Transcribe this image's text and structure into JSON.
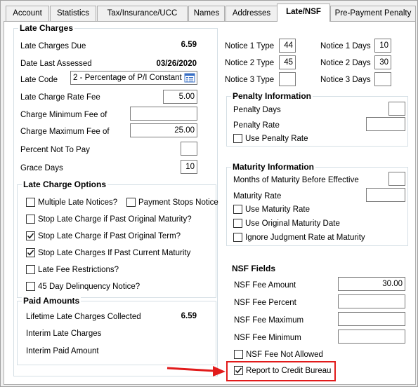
{
  "tabs": [
    {
      "label": "Account"
    },
    {
      "label": "Statistics"
    },
    {
      "label": "Tax/Insurance/UCC"
    },
    {
      "label": "Names"
    },
    {
      "label": "Addresses"
    },
    {
      "label": "Late/NSF"
    },
    {
      "label": "Pre-Payment Penalty"
    }
  ],
  "active_tab": "Late/NSF",
  "late_charges": {
    "title": "Late Charges",
    "due_label": "Late Charges Due",
    "due_value": "6.59",
    "date_label": "Date Last Assessed",
    "date_value": "03/26/2020",
    "code_label": "Late Code",
    "code_value": "2 - Percentage of P/I Constant",
    "rate_fee_label": "Late Charge Rate Fee",
    "rate_fee_value": "5.00",
    "min_fee_label": "Charge Minimum Fee of",
    "min_fee_value": "",
    "max_fee_label": "Charge Maximum Fee of",
    "max_fee_value": "25.00",
    "pct_not_pay_label": "Percent Not To Pay",
    "pct_not_pay_value": "",
    "grace_label": "Grace Days",
    "grace_value": "10"
  },
  "late_charge_options": {
    "title": "Late Charge Options",
    "multiple_notices": {
      "label": "Multiple Late Notices?",
      "checked": false
    },
    "payment_stops_notice": {
      "label": "Payment Stops Notice",
      "checked": false
    },
    "stop_past_orig_maturity": {
      "label": "Stop Late Charge if Past Original Maturity?",
      "checked": false
    },
    "stop_past_orig_term": {
      "label": "Stop Late Charge if Past Original Term?",
      "checked": true
    },
    "stop_past_current_maturity": {
      "label": "Stop Late Charges If Past Current Maturity",
      "checked": true
    },
    "late_fee_restrictions": {
      "label": "Late Fee Restrictions?",
      "checked": false
    },
    "delinquency_notice": {
      "label": "45 Day Delinquency Notice?",
      "checked": false
    }
  },
  "paid_amounts": {
    "title": "Paid Amounts",
    "lifetime_label": "Lifetime Late Charges Collected",
    "lifetime_value": "6.59",
    "interim_late_label": "Interim Late Charges",
    "interim_paid_label": "Interim Paid Amount"
  },
  "notices": {
    "notice1_type_label": "Notice 1 Type",
    "notice1_type_value": "44",
    "notice2_type_label": "Notice 2 Type",
    "notice2_type_value": "45",
    "notice3_type_label": "Notice 3 Type",
    "notice3_type_value": "",
    "notice1_days_label": "Notice 1 Days",
    "notice1_days_value": "10",
    "notice2_days_label": "Notice 2 Days",
    "notice2_days_value": "30",
    "notice3_days_label": "Notice 3 Days",
    "notice3_days_value": ""
  },
  "penalty_information": {
    "title": "Penalty Information",
    "days_label": "Penalty Days",
    "days_value": "",
    "rate_label": "Penalty Rate",
    "rate_value": "",
    "use_rate": {
      "label": "Use Penalty Rate",
      "checked": false
    }
  },
  "maturity_information": {
    "title": "Maturity Information",
    "months_label": "Months of Maturity Before Effective",
    "months_value": "",
    "rate_label": "Maturity Rate",
    "rate_value": "",
    "use_rate": {
      "label": "Use Maturity Rate",
      "checked": false
    },
    "use_orig_date": {
      "label": "Use Original Maturity Date",
      "checked": false
    },
    "ignore_judgment": {
      "label": "Ignore Judgment Rate at Maturity",
      "checked": false
    }
  },
  "nsf_fields": {
    "title": "NSF Fields",
    "fee_amount_label": "NSF Fee Amount",
    "fee_amount_value": "30.00",
    "fee_percent_label": "NSF Fee Percent",
    "fee_percent_value": "",
    "fee_max_label": "NSF Fee Maximum",
    "fee_max_value": "",
    "fee_min_label": "NSF Fee Minimum",
    "fee_min_value": "",
    "not_allowed": {
      "label": "NSF Fee Not Allowed",
      "checked": false
    },
    "report_credit": {
      "label": "Report to Credit Bureau",
      "checked": true
    }
  },
  "colors": {
    "highlight": "#e11b1b",
    "checkmark": "#1a1a1a"
  }
}
